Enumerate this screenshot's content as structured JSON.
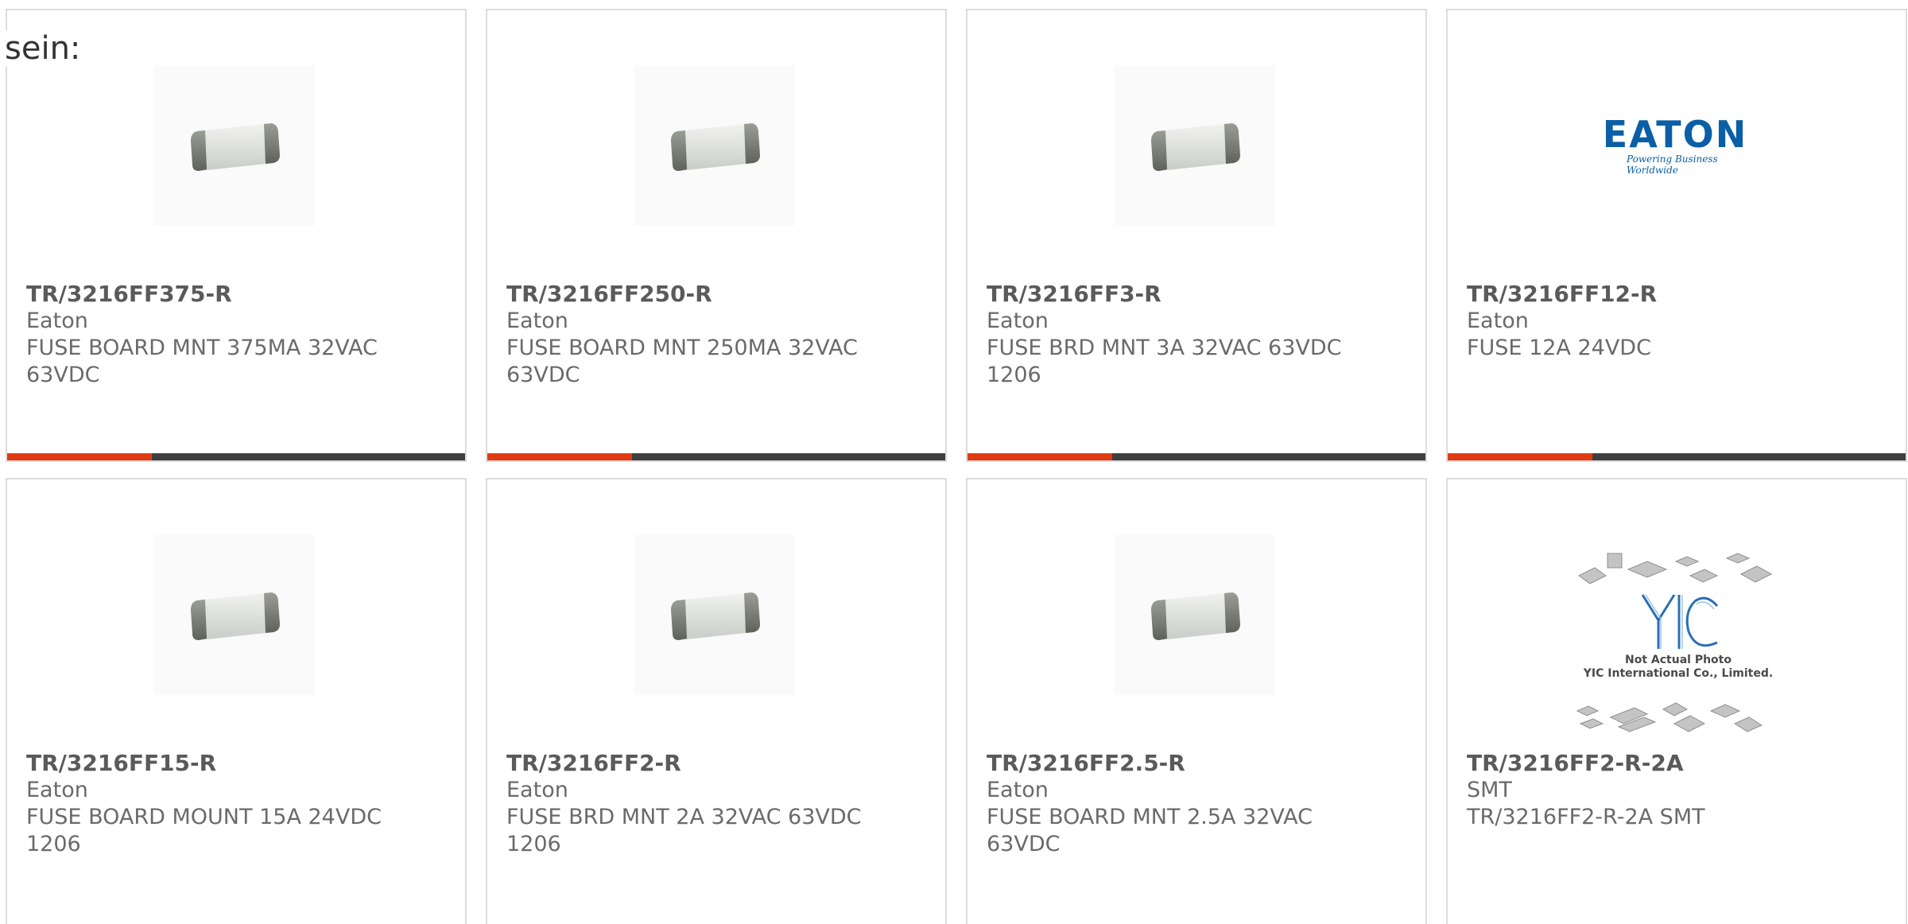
{
  "intro_text": "sein:",
  "colors": {
    "accent": "#e23a10",
    "bar": "#3f3f3f",
    "border": "#dcdcdc",
    "eaton_blue": "#0a5fa6"
  },
  "products": [
    {
      "part_number": "TR/3216FF375-R",
      "manufacturer": "Eaton",
      "description": "FUSE BOARD MNT 375MA 32VAC 63VDC",
      "image": "smd-fuse-photo"
    },
    {
      "part_number": "TR/3216FF250-R",
      "manufacturer": "Eaton",
      "description": "FUSE BOARD MNT 250MA 32VAC 63VDC",
      "image": "smd-fuse-photo"
    },
    {
      "part_number": "TR/3216FF3-R",
      "manufacturer": "Eaton",
      "description": "FUSE BRD MNT 3A 32VAC 63VDC 1206",
      "image": "smd-fuse-photo"
    },
    {
      "part_number": "TR/3216FF12-R",
      "manufacturer": "Eaton",
      "description": "FUSE 12A 24VDC",
      "image": "eaton-logo",
      "logo_word": "EATON",
      "logo_tagline": "Powering Business Worldwide"
    },
    {
      "part_number": "TR/3216FF15-R",
      "manufacturer": "Eaton",
      "description": "FUSE BOARD MOUNT 15A 24VDC 1206",
      "image": "smd-fuse-photo"
    },
    {
      "part_number": "TR/3216FF2-R",
      "manufacturer": "Eaton",
      "description": "FUSE BRD MNT 2A 32VAC 63VDC 1206",
      "image": "smd-fuse-photo"
    },
    {
      "part_number": "TR/3216FF2.5-R",
      "manufacturer": "Eaton",
      "description": "FUSE BOARD MNT 2.5A 32VAC 63VDC",
      "image": "smd-fuse-photo"
    },
    {
      "part_number": "TR/3216FF2-R-2A",
      "manufacturer": "SMT",
      "description": "TR/3216FF2-R-2A SMT",
      "image": "placeholder-not-actual-photo",
      "placeholder_line1": "Not Actual Photo",
      "placeholder_line2": "YIC International Co., Limited."
    }
  ]
}
